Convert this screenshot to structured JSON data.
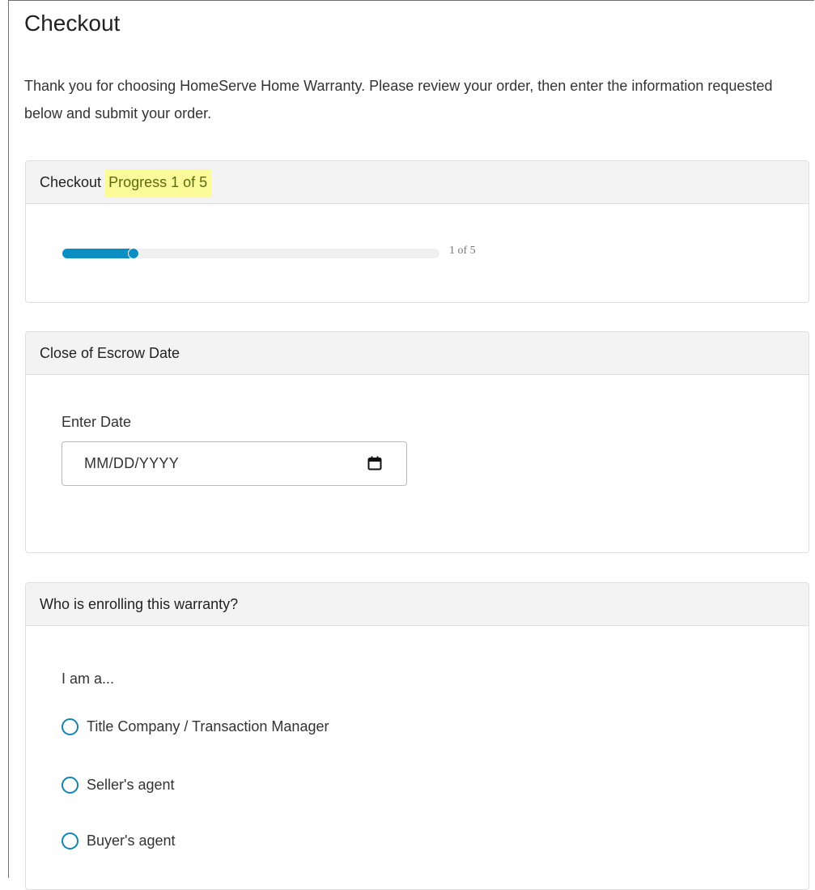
{
  "page": {
    "title": "Checkout",
    "intro": "Thank you for choosing HomeServe Home Warranty. Please review your order, then enter the information requested below and submit your order."
  },
  "progress_card": {
    "header_prefix": "Checkout",
    "header_highlight": "Progress 1 of 5",
    "progress_text": "1 of 5",
    "progress_fraction": 0.2,
    "bar_color": "#0b8fc3",
    "highlight_color": "#fbfb9a"
  },
  "escrow_card": {
    "header": "Close of Escrow Date",
    "field_label": "Enter Date",
    "date_placeholder": "MM/DD/YYYY",
    "calendar_icon": "calendar-icon"
  },
  "enroll_card": {
    "header": "Who is enrolling this warranty?",
    "question": "I am a...",
    "options": [
      {
        "label": "Title Company / Transaction Manager"
      },
      {
        "label": "Seller's agent"
      },
      {
        "label": "Buyer's agent"
      }
    ],
    "radio_color": "#1183b5"
  }
}
